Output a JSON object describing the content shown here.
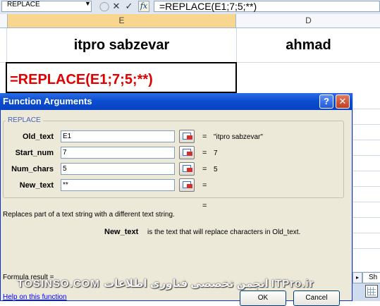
{
  "formula_bar": {
    "name_box": "REPLACE",
    "cancel_symbol": "✕",
    "enter_symbol": "✓",
    "fx_symbol": "fx",
    "formula": "=REPLACE(E1;7;5;**)"
  },
  "columns": [
    {
      "letter": "E"
    },
    {
      "letter": "D"
    }
  ],
  "cells": {
    "E1": "itpro sabzevar",
    "D1": "ahmad",
    "E2": "=REPLACE(E1;7;5;**)"
  },
  "dialog": {
    "title": "Function Arguments",
    "help_symbol": "?",
    "close_symbol": "✕",
    "function_name": "REPLACE",
    "arguments": [
      {
        "label": "Old_text",
        "value": "E1",
        "result": "\"itpro sabzevar\""
      },
      {
        "label": "Start_num",
        "value": "7",
        "result": "7"
      },
      {
        "label": "Num_chars",
        "value": "5",
        "result": "5"
      },
      {
        "label": "New_text",
        "value": "**",
        "result": ""
      }
    ],
    "equals": "=",
    "description": "Replaces part of a text string with a different text string.",
    "arg_help_name": "New_text",
    "arg_help_text": "is the text that will replace characters in Old_text.",
    "formula_result_label": "Formula result =",
    "help_link": "Help on this function",
    "ok_label": "OK",
    "cancel_label": "Cancel"
  },
  "sheet_tab": {
    "label": "Sh"
  },
  "watermark": "TOSINSO.COM  انجمن تخصصی فناوری اطلاعات ITPro.ir"
}
